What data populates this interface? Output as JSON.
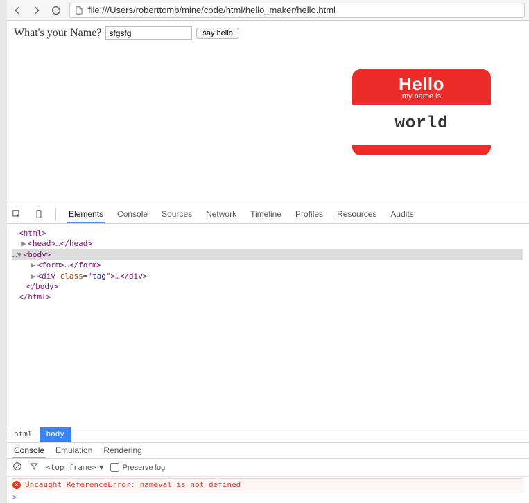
{
  "browser": {
    "url": "file:///Users/roberttomb/mine/code/html/hello_maker/hello.html"
  },
  "page": {
    "prompt_label": "What's your Name?",
    "name_value": "sfgsfg",
    "button_label": "say hello",
    "nametag": {
      "hello": "Hello",
      "subtitle": "my name is",
      "name": "world"
    }
  },
  "devtools": {
    "tabs": [
      "Elements",
      "Console",
      "Sources",
      "Network",
      "Timeline",
      "Profiles",
      "Resources",
      "Audits"
    ],
    "active_tab": "Elements",
    "dom": {
      "l0": "<html>",
      "l1_open": "<head>",
      "l1_ellip": "…",
      "l1_close": "</head>",
      "l2": "<body>",
      "l3_open": "<form>",
      "l3_ellip": "…",
      "l3_close": "</form>",
      "l4_open": "<div ",
      "l4_attrn": "class",
      "l4_eq": "=\"",
      "l4_attrv": "tag",
      "l4_q2": "\">",
      "l4_ellip": "…",
      "l4_close": "</div>",
      "l5": "</body>",
      "l6": "</html>"
    },
    "breadcrumb": [
      "html",
      "body"
    ],
    "console_tabs": [
      "Console",
      "Emulation",
      "Rendering"
    ],
    "frame_label": "<top frame>",
    "preserve_label": "Preserve log",
    "error_msg": "Uncaught ReferenceError: nameval is not defined",
    "prompt": ">"
  }
}
